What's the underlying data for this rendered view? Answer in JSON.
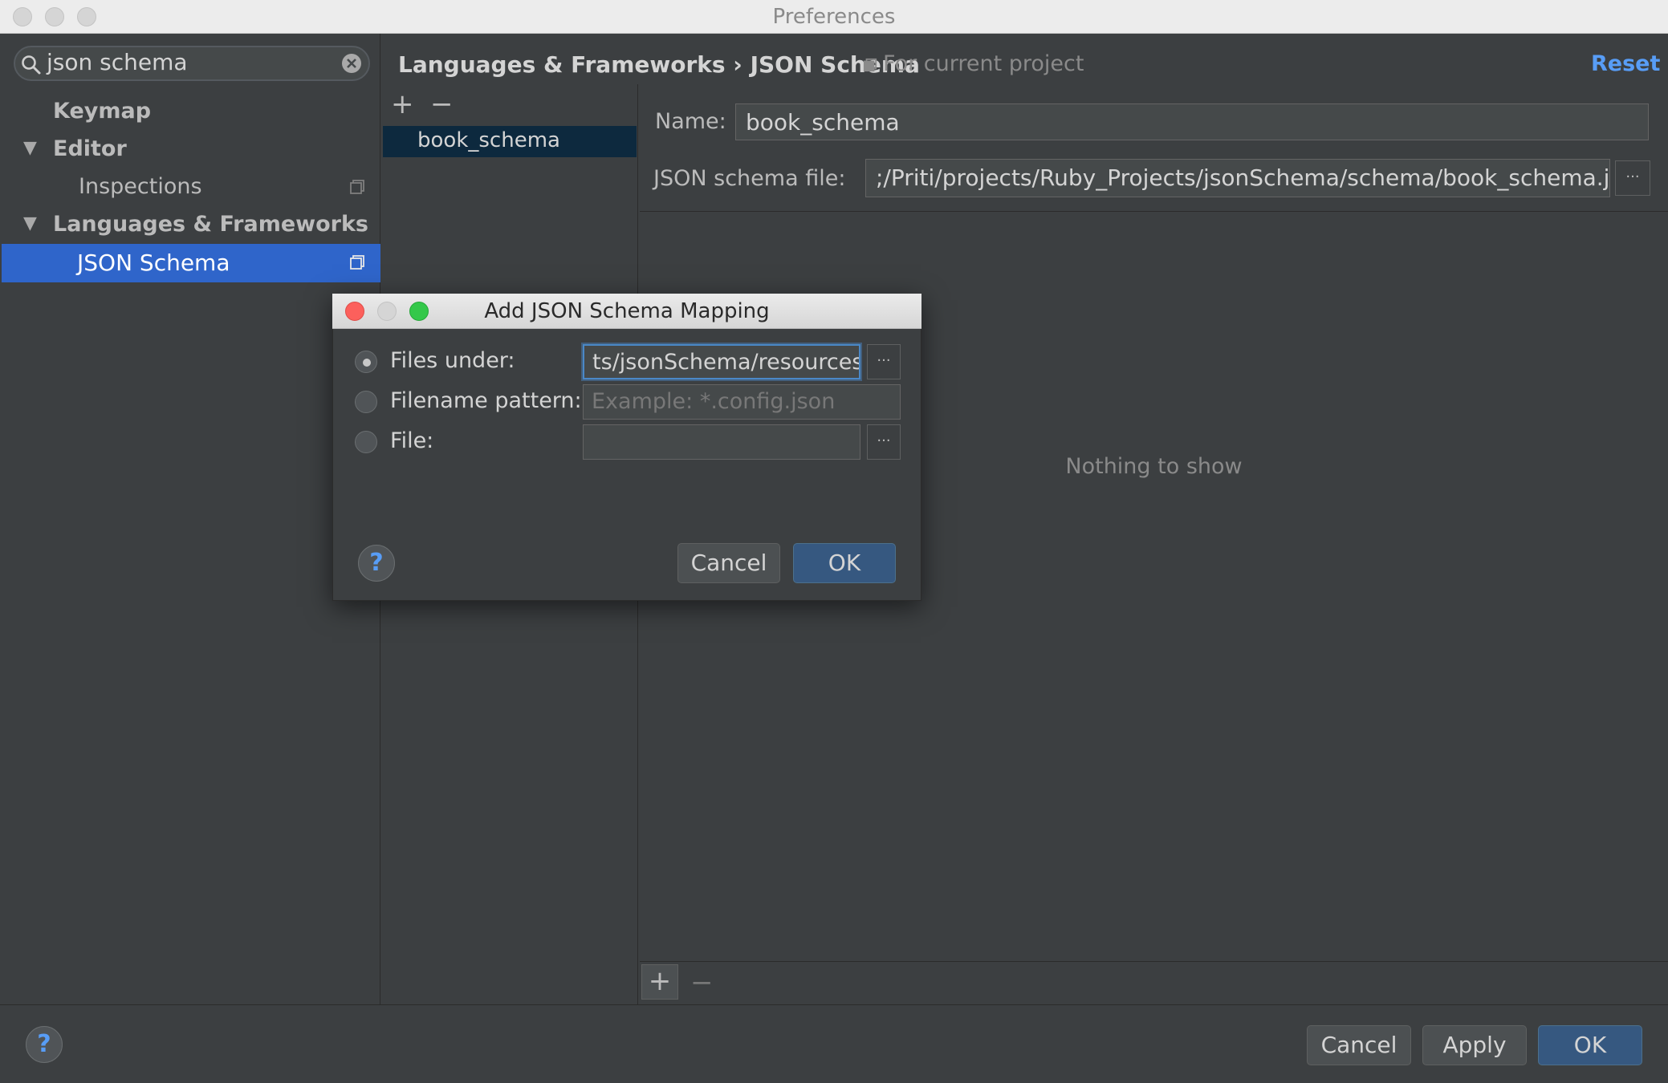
{
  "window": {
    "title": "Preferences"
  },
  "search": {
    "query": "json schema"
  },
  "sidebar": {
    "items": [
      {
        "label": "Keymap"
      },
      {
        "label": "Editor"
      },
      {
        "label": "Inspections"
      },
      {
        "label": "Languages & Frameworks"
      },
      {
        "label": "JSON Schema"
      }
    ]
  },
  "breadcrumb": {
    "path": "Languages & Frameworks › JSON Schema",
    "scope": "For current project",
    "reset": "Reset"
  },
  "mappings": {
    "add": "+",
    "remove": "−",
    "items": [
      {
        "label": "book_schema"
      }
    ]
  },
  "form": {
    "name_label": "Name:",
    "name_value": "book_schema",
    "file_label": "JSON schema file:",
    "file_value": ";/Priti/projects/Ruby_Projects/jsonSchema/schema/book_schema.json",
    "browse": "···",
    "empty_text": "Nothing to show",
    "add": "+",
    "remove": "−"
  },
  "footer": {
    "help": "?",
    "cancel": "Cancel",
    "apply": "Apply",
    "ok": "OK"
  },
  "dialog": {
    "title": "Add JSON Schema Mapping",
    "options": [
      {
        "label": "Files under:",
        "value": "ts/jsonSchema/resources",
        "selected": true
      },
      {
        "label": "Filename pattern:",
        "placeholder": "Example: *.config.json",
        "selected": false
      },
      {
        "label": "File:",
        "value": "",
        "selected": false
      }
    ],
    "browse": "···",
    "help": "?",
    "cancel": "Cancel",
    "ok": "OK"
  },
  "colors": {
    "background": "#3c3f41",
    "selection": "#2f65ca",
    "list_selection": "#0d293e",
    "accent_link": "#589df6",
    "default_button": "#365880"
  }
}
